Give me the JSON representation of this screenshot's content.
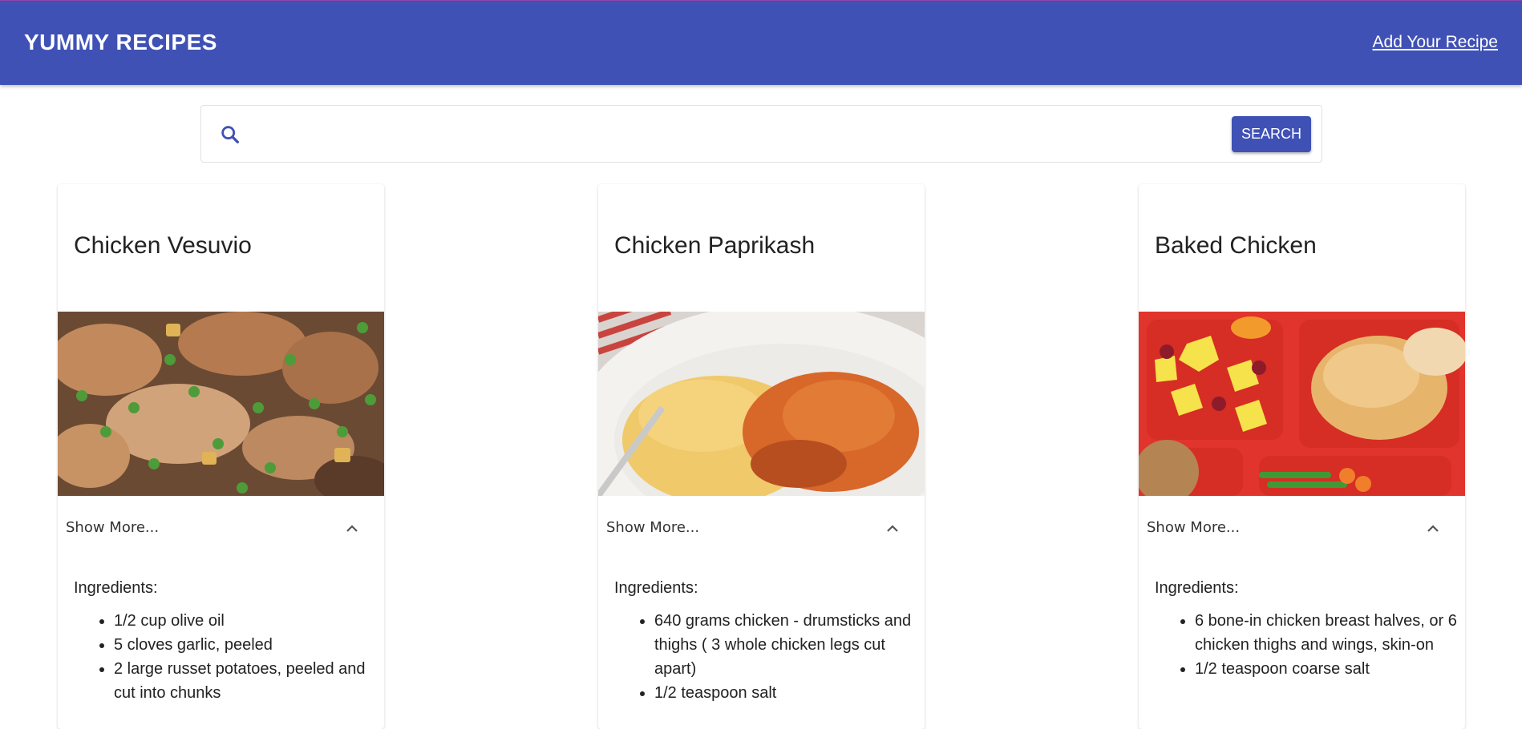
{
  "header": {
    "brand": "YUMMY RECIPES",
    "add_link": "Add Your Recipe",
    "bg_color": "#3f51b5"
  },
  "search": {
    "placeholder": "",
    "value": "",
    "button_label": "SEARCH",
    "icon": "search-icon"
  },
  "cards": [
    {
      "title": "Chicken Vesuvio",
      "show_more": "Show More...",
      "ingredients_label": "Ingredients:",
      "ingredients": [
        "1/2 cup olive oil",
        "5 cloves garlic, peeled",
        "2 large russet potatoes, peeled and cut into chunks"
      ]
    },
    {
      "title": "Chicken Paprikash",
      "show_more": "Show More...",
      "ingredients_label": "Ingredients:",
      "ingredients": [
        "640 grams chicken - drumsticks and thighs ( 3 whole chicken legs cut apart)",
        "1/2 teaspoon salt"
      ]
    },
    {
      "title": "Baked Chicken",
      "show_more": "Show More...",
      "ingredients_label": "Ingredients:",
      "ingredients": [
        "6 bone-in chicken breast halves, or 6 chicken thighs and wings, skin-on",
        "1/2 teaspoon coarse salt"
      ]
    }
  ]
}
